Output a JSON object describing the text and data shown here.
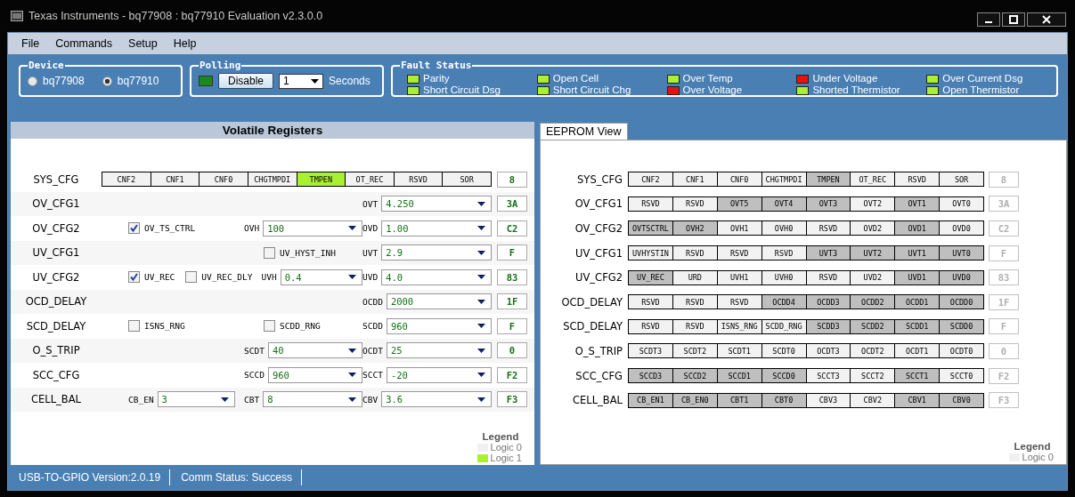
{
  "window": {
    "title": "Texas Instruments - bq77908 : bq77910 Evaluation v2.3.0.0"
  },
  "menu": [
    "File",
    "Commands",
    "Setup",
    "Help"
  ],
  "device": {
    "title": "Device",
    "options": [
      {
        "label": "bq77908",
        "selected": false
      },
      {
        "label": "bq77910",
        "selected": true
      }
    ]
  },
  "polling": {
    "title": "Polling",
    "indicator_on": true,
    "button": "Disable",
    "interval": "1",
    "unit": "Seconds"
  },
  "fault_status": {
    "title": "Fault Status",
    "items": [
      {
        "label": "Parity",
        "color": "#a8f030"
      },
      {
        "label": "Short Circuit Dsg",
        "color": "#a8f030"
      },
      {
        "label": "Open Cell",
        "color": "#a8f030"
      },
      {
        "label": "Short Circuit Chg",
        "color": "#a8f030"
      },
      {
        "label": "Over Temp",
        "color": "#a8f030"
      },
      {
        "label": "Over Voltage",
        "color": "#e81010"
      },
      {
        "label": "Under Voltage",
        "color": "#e81010"
      },
      {
        "label": "Shorted Thermistor",
        "color": "#a8f030"
      },
      {
        "label": "Over Current Dsg",
        "color": "#a8f030"
      },
      {
        "label": "Open Thermistor",
        "color": "#a8f030"
      }
    ]
  },
  "volatile": {
    "title": "Volatile Registers",
    "rows": [
      {
        "name": "SYS_CFG",
        "bits": [
          {
            "label": "CNF2",
            "on": false
          },
          {
            "label": "CNF1",
            "on": false
          },
          {
            "label": "CNF0",
            "on": false
          },
          {
            "label": "CHGTMPDI",
            "on": false
          },
          {
            "label": "TMPEN",
            "on": true
          },
          {
            "label": "OT_REC",
            "on": false
          },
          {
            "label": "RSVD",
            "on": false
          },
          {
            "label": "SOR",
            "on": false
          }
        ],
        "value": "8"
      },
      {
        "name": "OV_CFG1",
        "controls": [
          {
            "kind": "combo",
            "label": "OVT",
            "value": "4.250"
          }
        ],
        "value": "3A"
      },
      {
        "name": "OV_CFG2",
        "controls": [
          {
            "kind": "checkbox",
            "label": "OV_TS_CTRL",
            "checked": true
          },
          {
            "kind": "combo",
            "label": "OVH",
            "value": "100"
          },
          {
            "kind": "combo",
            "label": "OVD",
            "value": "1.00"
          }
        ],
        "value": "C2"
      },
      {
        "name": "UV_CFG1",
        "controls": [
          {
            "kind": "checkbox",
            "label": "UV_HYST_INH",
            "checked": false
          },
          {
            "kind": "combo",
            "label": "UVT",
            "value": "2.9"
          }
        ],
        "value": "F"
      },
      {
        "name": "UV_CFG2",
        "controls": [
          {
            "kind": "checkbox",
            "label": "UV_REC",
            "checked": true
          },
          {
            "kind": "checkbox",
            "label": "UV_REC_DLY",
            "checked": false
          },
          {
            "kind": "combo",
            "label": "UVH",
            "value": "0.4"
          },
          {
            "kind": "combo",
            "label": "UVD",
            "value": "4.0"
          }
        ],
        "value": "83"
      },
      {
        "name": "OCD_DELAY",
        "controls": [
          {
            "kind": "combo",
            "label": "OCDD",
            "value": "2000"
          }
        ],
        "value": "1F"
      },
      {
        "name": "SCD_DELAY",
        "controls": [
          {
            "kind": "checkbox",
            "label": "ISNS_RNG",
            "checked": false
          },
          {
            "kind": "checkbox",
            "label": "SCDD_RNG",
            "checked": false
          },
          {
            "kind": "combo",
            "label": "SCDD",
            "value": "960"
          }
        ],
        "value": "F"
      },
      {
        "name": "O_S_TRIP",
        "controls": [
          {
            "kind": "combo",
            "label": "SCDT",
            "value": "40"
          },
          {
            "kind": "combo",
            "label": "OCDT",
            "value": "25"
          }
        ],
        "value": "0"
      },
      {
        "name": "SCC_CFG",
        "controls": [
          {
            "kind": "combo",
            "label": "SCCD",
            "value": "960"
          },
          {
            "kind": "combo",
            "label": "SCCT",
            "value": "-20"
          }
        ],
        "value": "F2"
      },
      {
        "name": "CELL_BAL",
        "controls": [
          {
            "kind": "combo",
            "label": "CB_EN",
            "value": "3"
          },
          {
            "kind": "combo",
            "label": "CBT",
            "value": "8"
          },
          {
            "kind": "combo",
            "label": "CBV",
            "value": "3.6"
          }
        ],
        "value": "F3"
      }
    ],
    "legend": {
      "title": "Legend",
      "items": [
        {
          "label": "Logic 0",
          "color": "#f0f0f0"
        },
        {
          "label": "Logic 1",
          "color": "#a8f030"
        }
      ]
    }
  },
  "eeprom": {
    "tab": "EEPROM View",
    "rows": [
      {
        "name": "SYS_CFG",
        "bits": [
          {
            "label": "CNF2",
            "on": false
          },
          {
            "label": "CNF1",
            "on": false
          },
          {
            "label": "CNF0",
            "on": false
          },
          {
            "label": "CHGTMPDI",
            "on": false
          },
          {
            "label": "TMPEN",
            "on": true
          },
          {
            "label": "OT_REC",
            "on": false
          },
          {
            "label": "RSVD",
            "on": false
          },
          {
            "label": "SOR",
            "on": false
          }
        ],
        "value": "8"
      },
      {
        "name": "OV_CFG1",
        "bits": [
          {
            "label": "RSVD",
            "on": false
          },
          {
            "label": "RSVD",
            "on": false
          },
          {
            "label": "OVT5",
            "on": true
          },
          {
            "label": "OVT4",
            "on": true
          },
          {
            "label": "OVT3",
            "on": true
          },
          {
            "label": "OVT2",
            "on": false
          },
          {
            "label": "OVT1",
            "on": true
          },
          {
            "label": "OVT0",
            "on": false
          }
        ],
        "value": "3A"
      },
      {
        "name": "OV_CFG2",
        "bits": [
          {
            "label": "OVTSCTRL",
            "on": true
          },
          {
            "label": "OVH2",
            "on": true
          },
          {
            "label": "OVH1",
            "on": false
          },
          {
            "label": "OVH0",
            "on": false
          },
          {
            "label": "RSVD",
            "on": false
          },
          {
            "label": "OVD2",
            "on": false
          },
          {
            "label": "OVD1",
            "on": true
          },
          {
            "label": "OVD0",
            "on": false
          }
        ],
        "value": "C2"
      },
      {
        "name": "UV_CFG1",
        "bits": [
          {
            "label": "UVHYSTIN",
            "on": false
          },
          {
            "label": "RSVD",
            "on": false
          },
          {
            "label": "RSVD",
            "on": false
          },
          {
            "label": "RSVD",
            "on": false
          },
          {
            "label": "UVT3",
            "on": true
          },
          {
            "label": "UVT2",
            "on": true
          },
          {
            "label": "UVT1",
            "on": true
          },
          {
            "label": "UVT0",
            "on": true
          }
        ],
        "value": "F"
      },
      {
        "name": "UV_CFG2",
        "bits": [
          {
            "label": "UV_REC",
            "on": true
          },
          {
            "label": "URD",
            "on": false
          },
          {
            "label": "UVH1",
            "on": false
          },
          {
            "label": "UVH0",
            "on": false
          },
          {
            "label": "RSVD",
            "on": false
          },
          {
            "label": "UVD2",
            "on": false
          },
          {
            "label": "UVD1",
            "on": true
          },
          {
            "label": "UVD0",
            "on": true
          }
        ],
        "value": "83"
      },
      {
        "name": "OCD_DELAY",
        "bits": [
          {
            "label": "RSVD",
            "on": false
          },
          {
            "label": "RSVD",
            "on": false
          },
          {
            "label": "RSVD",
            "on": false
          },
          {
            "label": "OCDD4",
            "on": true
          },
          {
            "label": "OCDD3",
            "on": true
          },
          {
            "label": "OCDD2",
            "on": true
          },
          {
            "label": "OCDD1",
            "on": true
          },
          {
            "label": "OCDD0",
            "on": true
          }
        ],
        "value": "1F"
      },
      {
        "name": "SCD_DELAY",
        "bits": [
          {
            "label": "RSVD",
            "on": false
          },
          {
            "label": "RSVD",
            "on": false
          },
          {
            "label": "ISNS_RNG",
            "on": false
          },
          {
            "label": "SCDD_RNG",
            "on": false
          },
          {
            "label": "SCDD3",
            "on": true
          },
          {
            "label": "SCDD2",
            "on": true
          },
          {
            "label": "SCDD1",
            "on": true
          },
          {
            "label": "SCDD0",
            "on": true
          }
        ],
        "value": "F"
      },
      {
        "name": "O_S_TRIP",
        "bits": [
          {
            "label": "SCDT3",
            "on": false
          },
          {
            "label": "SCDT2",
            "on": false
          },
          {
            "label": "SCDT1",
            "on": false
          },
          {
            "label": "SCDT0",
            "on": false
          },
          {
            "label": "OCDT3",
            "on": false
          },
          {
            "label": "OCDT2",
            "on": false
          },
          {
            "label": "OCDT1",
            "on": false
          },
          {
            "label": "OCDT0",
            "on": false
          }
        ],
        "value": "0"
      },
      {
        "name": "SCC_CFG",
        "bits": [
          {
            "label": "SCCD3",
            "on": true
          },
          {
            "label": "SCCD2",
            "on": true
          },
          {
            "label": "SCCD1",
            "on": true
          },
          {
            "label": "SCCD0",
            "on": true
          },
          {
            "label": "SCCT3",
            "on": false
          },
          {
            "label": "SCCT2",
            "on": false
          },
          {
            "label": "SCCT1",
            "on": true
          },
          {
            "label": "SCCT0",
            "on": false
          }
        ],
        "value": "F2"
      },
      {
        "name": "CELL_BAL",
        "bits": [
          {
            "label": "CB_EN1",
            "on": true
          },
          {
            "label": "CB_EN0",
            "on": true
          },
          {
            "label": "CBT1",
            "on": true
          },
          {
            "label": "CBT0",
            "on": true
          },
          {
            "label": "CBV3",
            "on": false
          },
          {
            "label": "CBV2",
            "on": false
          },
          {
            "label": "CBV1",
            "on": true
          },
          {
            "label": "CBV0",
            "on": true
          }
        ],
        "value": "F3"
      }
    ],
    "legend": {
      "title": "Legend",
      "items": [
        {
          "label": "Logic 0",
          "color": "#f0f0f0"
        }
      ]
    }
  },
  "status_bar": [
    "USB-TO-GPIO Version:2.0.19",
    "Comm Status: Success"
  ]
}
